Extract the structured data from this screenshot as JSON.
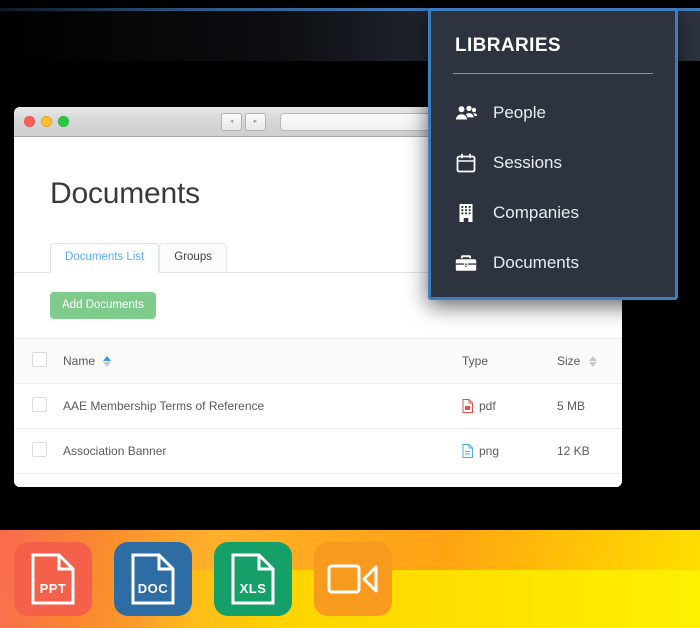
{
  "window": {
    "traffic_lights": [
      "close",
      "minimize",
      "zoom"
    ],
    "back_glyph": "◂",
    "forward_glyph": "▸",
    "address_value": ""
  },
  "page": {
    "title": "Documents",
    "tabs": [
      {
        "label": "Documents List",
        "active": true
      },
      {
        "label": "Groups",
        "active": false
      }
    ],
    "add_button": "Add Documents",
    "table": {
      "columns": [
        {
          "label": "",
          "sortable": false
        },
        {
          "label": "Name",
          "sortable": true,
          "sort": "asc"
        },
        {
          "label": "Type",
          "sortable": false
        },
        {
          "label": "Size",
          "sortable": true,
          "sort": "none"
        }
      ],
      "rows": [
        {
          "name": "AAE Membership Terms of Reference",
          "type": "pdf",
          "type_icon": "pdf-file-icon",
          "type_color": "#ef4b4b",
          "size": "5 MB"
        },
        {
          "name": "Association Banner",
          "type": "png",
          "type_icon": "image-file-icon",
          "type_color": "#4aa8ef",
          "size": "12 KB"
        }
      ]
    }
  },
  "libraries": {
    "title": "LIBRARIES",
    "border_color": "#3c7ebf",
    "background_color": "#2d3440",
    "items": [
      {
        "label": "People",
        "icon": "users-icon"
      },
      {
        "label": "Sessions",
        "icon": "calendar-icon"
      },
      {
        "label": "Companies",
        "icon": "building-icon"
      },
      {
        "label": "Documents",
        "icon": "briefcase-icon"
      }
    ]
  },
  "filetype_band": {
    "tiles": [
      {
        "label": "PPT",
        "icon": "ppt-file-icon",
        "color": "#f4604a"
      },
      {
        "label": "DOC",
        "icon": "doc-file-icon",
        "color": "#2e6da4"
      },
      {
        "label": "XLS",
        "icon": "xls-file-icon",
        "color": "#15a06a"
      },
      {
        "label": "",
        "icon": "video-camera-icon",
        "color": "#f79a1e"
      }
    ]
  }
}
